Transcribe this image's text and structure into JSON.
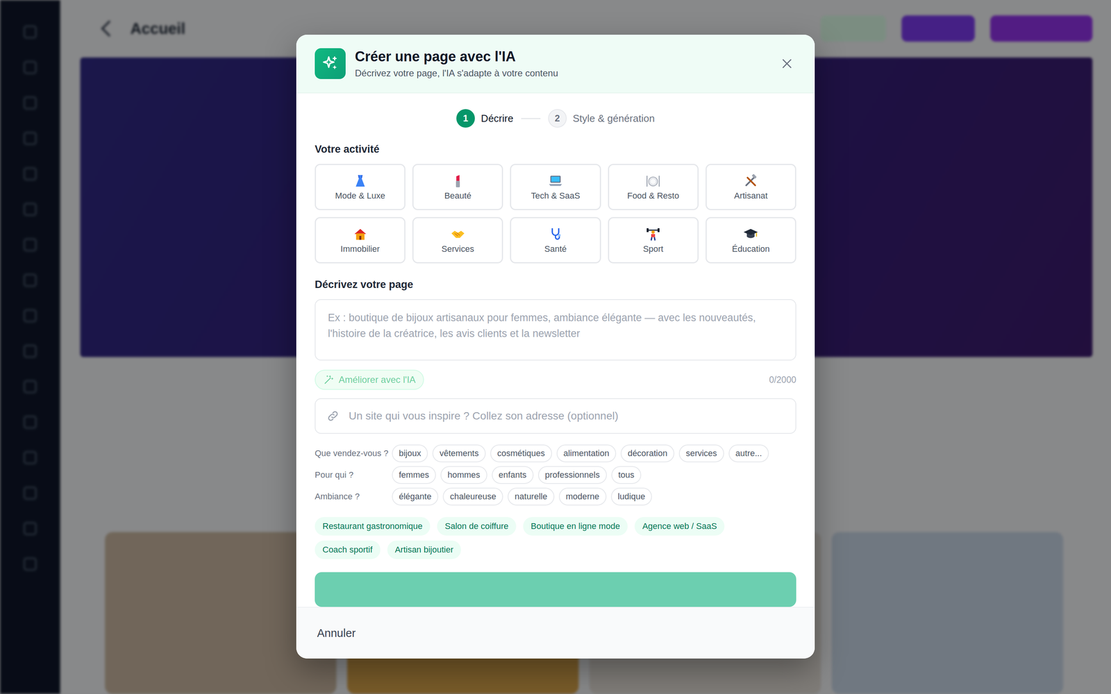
{
  "app": {
    "title": "Accueil"
  },
  "dialog": {
    "title": "Créer une page avec l'IA",
    "subtitle": "Décrivez votre page, l'IA s'adapte à votre contenu",
    "steps": [
      {
        "number": "1",
        "label": "Décrire",
        "selected": true
      },
      {
        "number": "2",
        "label": "Style & génération",
        "selected": false
      }
    ],
    "activity": {
      "label": "Votre activité",
      "items": [
        {
          "label": "Mode & Luxe",
          "selected": false
        },
        {
          "label": "Beauté",
          "selected": false
        },
        {
          "label": "Tech & SaaS",
          "selected": false
        },
        {
          "label": "Food & Resto",
          "selected": false
        },
        {
          "label": "Artisanat",
          "selected": false
        },
        {
          "label": "Immobilier",
          "selected": false
        },
        {
          "label": "Services",
          "selected": false
        },
        {
          "label": "Santé",
          "selected": false
        },
        {
          "label": "Sport",
          "selected": false
        },
        {
          "label": "Éducation",
          "selected": false
        }
      ]
    },
    "description": {
      "label": "Décrivez votre page",
      "placeholder": "Ex : boutique de bijoux artisanaux pour femmes, ambiance élégante — avec les nouveautés, l'histoire de la créatrice, les avis clients et la newsletter",
      "improve": {
        "label": "Améliorer avec l'IA",
        "disabled": true
      },
      "counter": "0/2000"
    },
    "inspiration": {
      "placeholder": "Un site qui vous inspire ? Collez son adresse (optionnel)"
    },
    "chip_groups": [
      {
        "label": "Que vendez-vous ?",
        "chips": [
          {
            "label": "bijoux",
            "selected": false
          },
          {
            "label": "vêtements",
            "selected": false
          },
          {
            "label": "cosmétiques",
            "selected": false
          },
          {
            "label": "alimentation",
            "selected": false
          },
          {
            "label": "décoration",
            "selected": false
          },
          {
            "label": "services",
            "selected": false
          },
          {
            "label": "autre...",
            "selected": false
          }
        ]
      },
      {
        "label": "Pour qui ?",
        "chips": [
          {
            "label": "femmes",
            "selected": false
          },
          {
            "label": "hommes",
            "selected": false
          },
          {
            "label": "enfants",
            "selected": false
          },
          {
            "label": "professionnels",
            "selected": false
          },
          {
            "label": "tous",
            "selected": false
          }
        ]
      },
      {
        "label": "Ambiance ?",
        "chips": [
          {
            "label": "élégante",
            "selected": false
          },
          {
            "label": "chaleureuse",
            "selected": false
          },
          {
            "label": "naturelle",
            "selected": false
          },
          {
            "label": "moderne",
            "selected": false
          },
          {
            "label": "ludique",
            "selected": false
          }
        ]
      }
    ],
    "suggestions": [
      "Restaurant gastronomique",
      "Salon de coiffure",
      "Boutique en ligne mode",
      "Agence web / SaaS",
      "Coach sportif",
      "Artisan bijoutier"
    ],
    "cancel": "Annuler"
  }
}
